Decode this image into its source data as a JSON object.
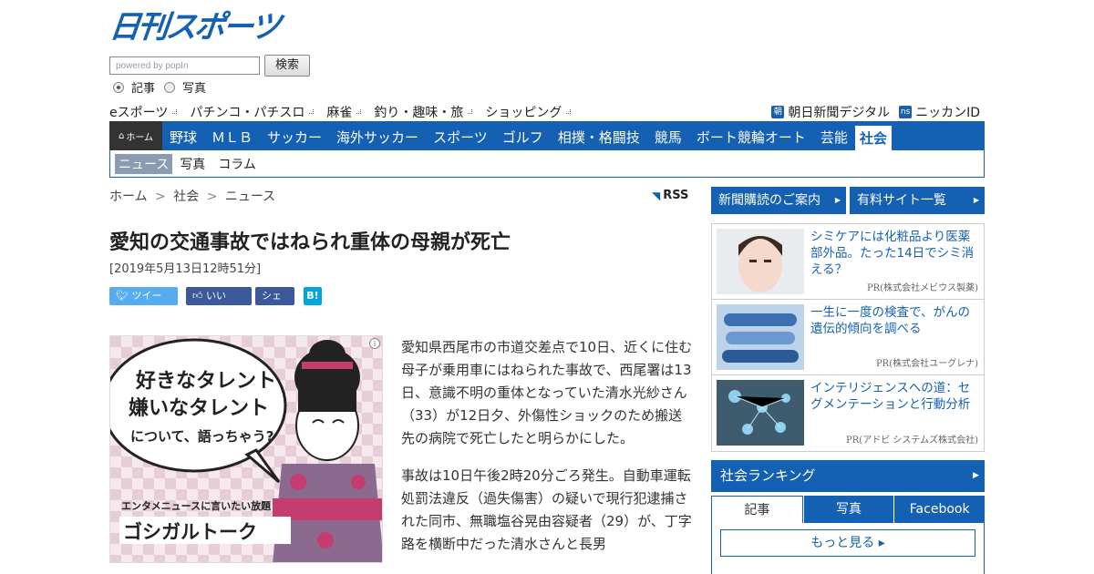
{
  "header": {
    "logo_text": "日刊スポーツ",
    "search_placeholder": "powered by popIn",
    "search_button": "検索",
    "radio_article": "記事",
    "radio_photo": "写真"
  },
  "subnav": [
    "eスポーツ",
    "パチンコ・パチスロ",
    "麻雀",
    "釣り・趣味・旅",
    "ショッピング"
  ],
  "extlinks": {
    "asahi_badge": "朝",
    "asahi": "朝日新聞デジタル",
    "ns_badge": "ns",
    "nikkan_id": "ニッカンID"
  },
  "mainnav": {
    "home": "ホーム",
    "items": [
      "野球",
      "ＭＬＢ",
      "サッカー",
      "海外サッカー",
      "スポーツ",
      "ゴルフ",
      "相撲・格闘技",
      "競馬",
      "ボート競輪オート",
      "芸能",
      "社会"
    ],
    "active": "社会"
  },
  "subnav2": {
    "selected": "ニュース",
    "items": [
      "写真",
      "コラム"
    ]
  },
  "breadcrumb": {
    "home": "ホーム",
    "section": "社会",
    "current": "ニュース",
    "sep": ">"
  },
  "rss": "RSS",
  "article": {
    "title": "愛知の交通事故ではねられ重体の母親が死亡",
    "date": "[2019年5月13日12時51分]",
    "para1": "愛知県西尾市の市道交差点で10日、近くに住む母子が乗用車にはねられた事故で、西尾署は13日、意識不明の重体となっていた清水光紗さん（33）が12日夕、外傷性ショックのため搬送先の病院で死亡したと明らかにした。",
    "para2": "事故は10日午後2時20分ごろ発生。自動車運転処罰法違反（過失傷害）の疑いで現行犯逮捕された同市、無職塩谷晃由容疑者（29）が、丁字路を横断中だった清水さんと長男"
  },
  "share": {
    "tweet": "ツイート",
    "like": "いいね！",
    "share": "シェア",
    "hatena": "B!"
  },
  "ad": {
    "line1": "好きなタレント",
    "line2": "嫌いなタレント",
    "line3": "について、語っちゃう?",
    "tagline": "エンタメニュースに言いたい放題",
    "brand": "ゴシガルトーク",
    "info_icon": "i"
  },
  "sidebar": {
    "btn1": "新聞購読のご案内",
    "btn2": "有料サイト一覧",
    "pr": [
      {
        "title": "シミケアには化粧品より医薬部外品。たった14日でシミ消える？",
        "credit": "PR(株式会社メビウス製薬)"
      },
      {
        "title": "一生に一度の検査で、がんの遺伝的傾向を調べる",
        "credit": "PR(株式会社ユーグレナ)"
      },
      {
        "title": "インテリジェンスへの道：セグメンテーションと行動分析",
        "credit": "PR(アドビ システムズ株式会社)"
      }
    ],
    "ranking": "社会ランキング",
    "tabs": [
      "記事",
      "写真",
      "Facebook"
    ],
    "more": "もっと見る ▸"
  },
  "colors": {
    "brand_blue": "#1461b3",
    "nav_home_bg": "#333333"
  }
}
